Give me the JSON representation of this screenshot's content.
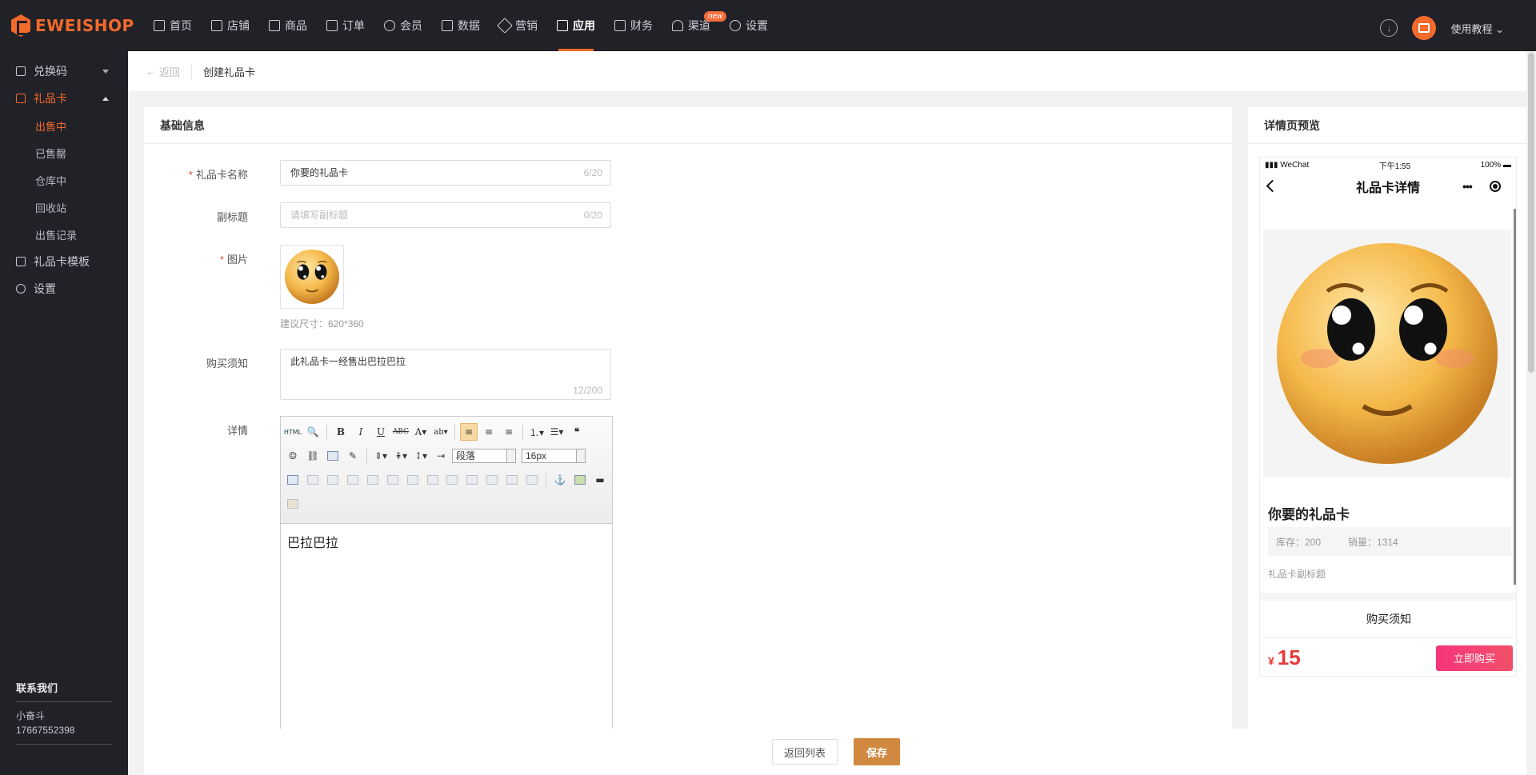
{
  "brand": {
    "name": "EWEISHOP",
    "accent": "#f36a2a"
  },
  "nav": [
    {
      "label": "首页",
      "icon": "home-icon"
    },
    {
      "label": "店铺",
      "icon": "shop-icon"
    },
    {
      "label": "商品",
      "icon": "goods-icon"
    },
    {
      "label": "订单",
      "icon": "order-icon"
    },
    {
      "label": "会员",
      "icon": "user-icon"
    },
    {
      "label": "数据",
      "icon": "chart-icon"
    },
    {
      "label": "营销",
      "icon": "tag-icon"
    },
    {
      "label": "应用",
      "icon": "app-icon",
      "active": true
    },
    {
      "label": "财务",
      "icon": "finance-icon"
    },
    {
      "label": "渠道",
      "icon": "channel-icon",
      "badge": "new"
    },
    {
      "label": "设置",
      "icon": "gear-icon"
    }
  ],
  "top_right": {
    "help": "使用教程"
  },
  "sidebar": {
    "items": [
      {
        "label": "兑换码"
      },
      {
        "label": "礼品卡"
      }
    ],
    "sub_items": [
      "出售中",
      "已售罄",
      "仓库中",
      "回收站",
      "出售记录"
    ],
    "after": [
      {
        "label": "礼品卡模板"
      },
      {
        "label": "设置"
      }
    ],
    "contact": {
      "title": "联系我们",
      "name": "小奋斗",
      "phone": "17667552398"
    }
  },
  "breadcrumb": {
    "back": "返回",
    "title": "创建礼品卡"
  },
  "form": {
    "section_title": "基础信息",
    "name": {
      "label": "礼品卡名称",
      "value": "你要的礼品卡",
      "count": "6/20"
    },
    "subtitle": {
      "label": "副标题",
      "placeholder": "请填写副标题",
      "count": "0/20"
    },
    "image": {
      "label": "图片",
      "hint": "建议尺寸：620*360"
    },
    "notice": {
      "label": "购买须知",
      "value": "此礼品卡一经售出巴拉巴拉",
      "count": "12/200"
    },
    "detail": {
      "label": "详情",
      "content": "巴拉巴拉",
      "paragraph_select": "段落",
      "font_size_select": "16px"
    }
  },
  "preview": {
    "title": "详情页预览",
    "status": {
      "carrier": "WeChat",
      "time": "下午1:55",
      "battery": "100%"
    },
    "page_title": "礼品卡详情",
    "card_name": "你要的礼品卡",
    "stock": "库存：200",
    "sales": "销量：1314",
    "subtitle": "礼品卡副标题",
    "notice_title": "购买须知",
    "currency": "¥",
    "price": "15",
    "buy": "立即购买"
  },
  "footer": {
    "back_list": "返回列表",
    "save": "保存"
  }
}
